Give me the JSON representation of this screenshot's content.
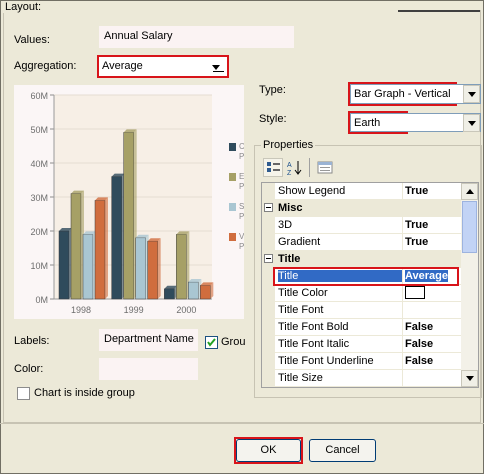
{
  "layout": {
    "label": "Layout:"
  },
  "values": {
    "label": "Values:",
    "value": "Annual Salary"
  },
  "aggregation": {
    "label": "Aggregation:",
    "value": "Average"
  },
  "type": {
    "label": "Type:",
    "value": "Bar Graph - Vertical"
  },
  "style": {
    "label": "Style:",
    "value": "Earth"
  },
  "properties": {
    "label": "Properties",
    "rows": [
      {
        "name": "Show Legend",
        "value": "True",
        "kind": "prop"
      },
      {
        "name": "Misc",
        "value": "",
        "kind": "category"
      },
      {
        "name": "3D",
        "value": "True",
        "kind": "prop"
      },
      {
        "name": "Gradient",
        "value": "True",
        "kind": "prop"
      },
      {
        "name": "Title",
        "value": "",
        "kind": "category"
      },
      {
        "name": "Title",
        "value": "Average",
        "kind": "selected"
      },
      {
        "name": "Title Color",
        "value": "",
        "kind": "color"
      },
      {
        "name": "Title Font",
        "value": "",
        "kind": "prop"
      },
      {
        "name": "Title Font Bold",
        "value": "False",
        "kind": "prop"
      },
      {
        "name": "Title Font Italic",
        "value": "False",
        "kind": "prop"
      },
      {
        "name": "Title Font Underline",
        "value": "False",
        "kind": "prop"
      },
      {
        "name": "Title Size",
        "value": "",
        "kind": "prop"
      }
    ]
  },
  "labels": {
    "label": "Labels:",
    "value": "Department Name",
    "group_label": "Grou"
  },
  "color": {
    "label": "Color:",
    "value": ""
  },
  "chart_inside": {
    "label": "Chart is inside group"
  },
  "buttons": {
    "ok": "OK",
    "cancel": "Cancel"
  },
  "chart_data": {
    "type": "bar",
    "categories": [
      "1998",
      "1999",
      "2000"
    ],
    "series": [
      {
        "values": [
          20,
          36,
          3
        ],
        "color": "#2f4b5c"
      },
      {
        "values": [
          31,
          49,
          19
        ],
        "color": "#a6a066"
      },
      {
        "values": [
          19,
          18,
          5
        ],
        "color": "#a9c6d2"
      },
      {
        "values": [
          29,
          17,
          4
        ],
        "color": "#d06d3e"
      }
    ],
    "yticks": [
      "0M",
      "10M",
      "20M",
      "30M",
      "40M",
      "50M",
      "60M"
    ],
    "ylim": [
      0,
      60
    ],
    "legend": [
      "C\nP",
      "E\nP",
      "S\nP",
      "V\nP"
    ]
  }
}
